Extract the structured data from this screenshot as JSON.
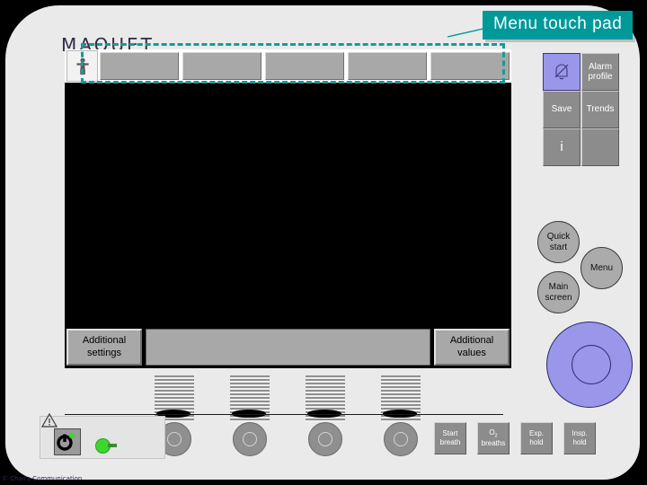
{
  "annotation": {
    "callout_label": "Menu touch pad"
  },
  "device": {
    "brand": "MAQUET",
    "watermark": "© Chaira Communication"
  },
  "screen": {
    "patient_icon": "patient-figure-icon",
    "tabs": [
      {
        "label": ""
      },
      {
        "label": ""
      },
      {
        "label": ""
      },
      {
        "label": ""
      },
      {
        "label": ""
      }
    ],
    "bottom_left_button": "Additional\nsettings",
    "bottom_left_line1": "Additional",
    "bottom_left_line2": "settings",
    "bottom_right_line1": "Additional",
    "bottom_right_line2": "values"
  },
  "button_grid": [
    {
      "name": "alarm-silence",
      "icon": "bell-slash-icon",
      "label": "",
      "accent": "#9a96ea"
    },
    {
      "name": "alarm-profile",
      "icon": "",
      "label": "Alarm\nprofile",
      "line1": "Alarm",
      "line2": "profile"
    },
    {
      "name": "save",
      "icon": "",
      "label": "Save",
      "line1": "Save",
      "line2": ""
    },
    {
      "name": "trends",
      "icon": "",
      "label": "Trends",
      "line1": "Trends",
      "line2": ""
    },
    {
      "name": "info",
      "icon": "",
      "label": "i",
      "line1": "i",
      "line2": ""
    },
    {
      "name": "blank",
      "icon": "",
      "label": "",
      "line1": "",
      "line2": ""
    }
  ],
  "circle_buttons": [
    {
      "name": "quick-start",
      "line1": "Quick",
      "line2": "start"
    },
    {
      "name": "menu",
      "line1": "Menu",
      "line2": ""
    },
    {
      "name": "main-screen",
      "line1": "Main",
      "line2": "screen"
    }
  ],
  "function_buttons": [
    {
      "name": "start-breath",
      "line1": "Start",
      "line2": "breath"
    },
    {
      "name": "o2-breaths",
      "line1": "O",
      "sub": "2",
      "line2": "breaths"
    },
    {
      "name": "exp-hold",
      "line1": "Exp.",
      "line2": "hold"
    },
    {
      "name": "insp-hold",
      "line1": "Insp.",
      "line2": "hold"
    }
  ],
  "indicators": {
    "warning_icon": "warning-triangle-icon",
    "power_icon": "power-icon",
    "led_color": "#3bd72e"
  },
  "colors": {
    "callout_bg": "#009999",
    "selection_border": "#179a9a",
    "accent_purple": "#9a96ea",
    "body_gray": "#eaeaea",
    "button_gray": "#8c8c8c"
  }
}
